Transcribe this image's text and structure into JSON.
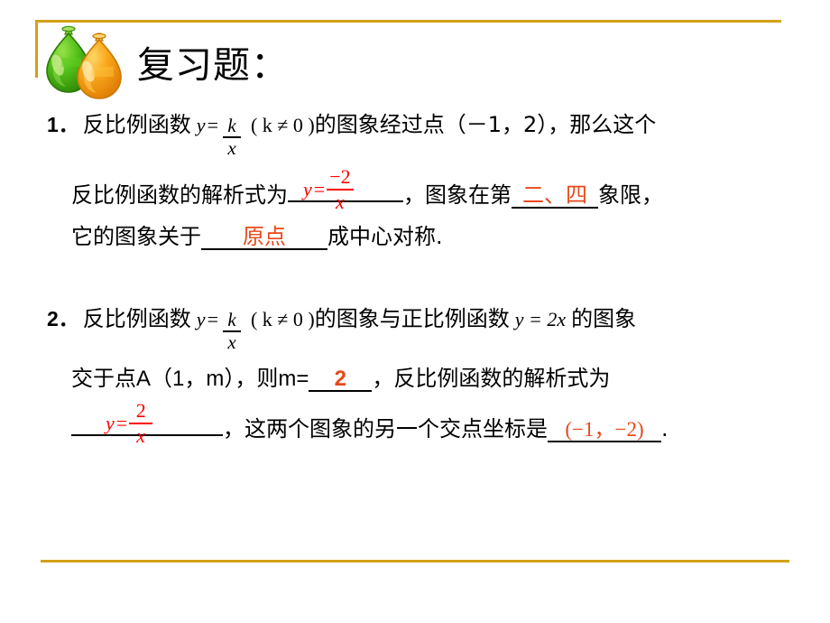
{
  "slide": {
    "title": "复习题：",
    "accent_color": "#D4A017",
    "answer_red": "#FF0000",
    "answer_orange": "#E8491D",
    "decor_icon": "balloons-icon"
  },
  "questions": [
    {
      "number": "1．",
      "line1": {
        "before_formula": "反比例函数",
        "formula_y": "y",
        "formula_eq": "=",
        "formula_numer": "k",
        "formula_denom": "x",
        "condition": "( k ≠ 0 )",
        "after": "的图象经过点（－1，2），那么这个"
      },
      "line2": {
        "before_blank": "反比例函数的解析式为",
        "answer_y": "y",
        "answer_eq": "=",
        "answer_numer": "−2",
        "answer_denom": "x",
        "mid_text": "，图象在第",
        "answer_quadrant": "二、四",
        "after_text": "象限，"
      },
      "line3": {
        "before_blank": "它的图象关于",
        "answer_origin": "原点",
        "after_blank": "成中心对称."
      }
    },
    {
      "number": "2．",
      "line1": {
        "before_formula": "反比例函数",
        "formula_y": "y",
        "formula_eq": "=",
        "formula_numer": "k",
        "formula_denom": "x",
        "condition": "( k ≠ 0 )",
        "mid": "的图象与正比例函数",
        "formula2": "y = 2x",
        "after": "的图象"
      },
      "line2": {
        "before_blank": "交于点A（1，m），则m=",
        "answer_m": "2",
        "after_blank": "，反比例函数的解析式为"
      },
      "line3": {
        "answer_y": "y",
        "answer_eq": "=",
        "answer_numer": "2",
        "answer_denom": "x",
        "mid_text": "，这两个图象的另一个交点坐标是",
        "answer_point": "(−1，−2)",
        "period": "."
      }
    }
  ]
}
